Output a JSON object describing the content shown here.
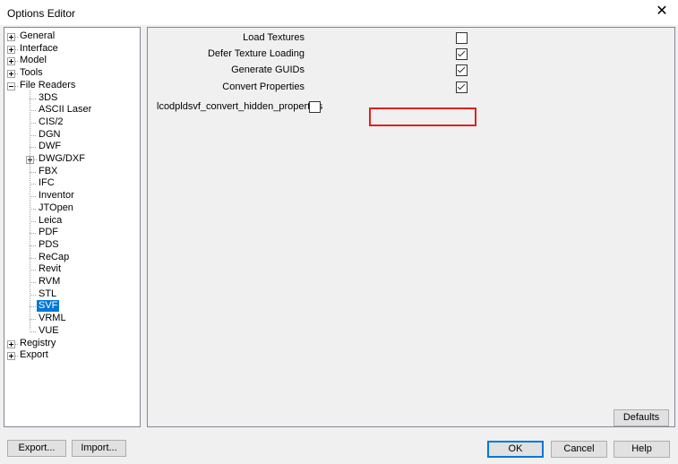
{
  "window": {
    "title": "Options Editor",
    "close_glyph": "✕"
  },
  "tree": {
    "nodes": [
      {
        "label": "General",
        "expander": "plus"
      },
      {
        "label": "Interface",
        "expander": "plus"
      },
      {
        "label": "Model",
        "expander": "plus"
      },
      {
        "label": "Tools",
        "expander": "plus"
      },
      {
        "label": "File Readers",
        "expander": "minus"
      },
      {
        "label": "3DS"
      },
      {
        "label": "ASCII Laser"
      },
      {
        "label": "CIS/2"
      },
      {
        "label": "DGN"
      },
      {
        "label": "DWF"
      },
      {
        "label": "DWG/DXF",
        "expander": "plus"
      },
      {
        "label": "FBX"
      },
      {
        "label": "IFC"
      },
      {
        "label": "Inventor"
      },
      {
        "label": "JTOpen"
      },
      {
        "label": "Leica"
      },
      {
        "label": "PDF"
      },
      {
        "label": "PDS"
      },
      {
        "label": "ReCap"
      },
      {
        "label": "Revit"
      },
      {
        "label": "RVM"
      },
      {
        "label": "STL"
      },
      {
        "label": "SVF",
        "selected": true
      },
      {
        "label": "VRML"
      },
      {
        "label": "VUE"
      },
      {
        "label": "Registry",
        "expander": "plus"
      },
      {
        "label": "Export",
        "expander": "plus"
      }
    ]
  },
  "options": [
    {
      "label": "Load Textures",
      "checked": false
    },
    {
      "label": "Defer Texture Loading",
      "checked": true
    },
    {
      "label": "Generate GUIDs",
      "checked": true
    },
    {
      "label": "Convert Properties",
      "checked": true
    },
    {
      "label": "lcodpldsvf_convert_hidden_properties",
      "checked": false
    }
  ],
  "buttons": {
    "defaults": "Defaults",
    "export": "Export...",
    "import": "Import...",
    "ok": "OK",
    "cancel": "Cancel",
    "help": "Help"
  }
}
